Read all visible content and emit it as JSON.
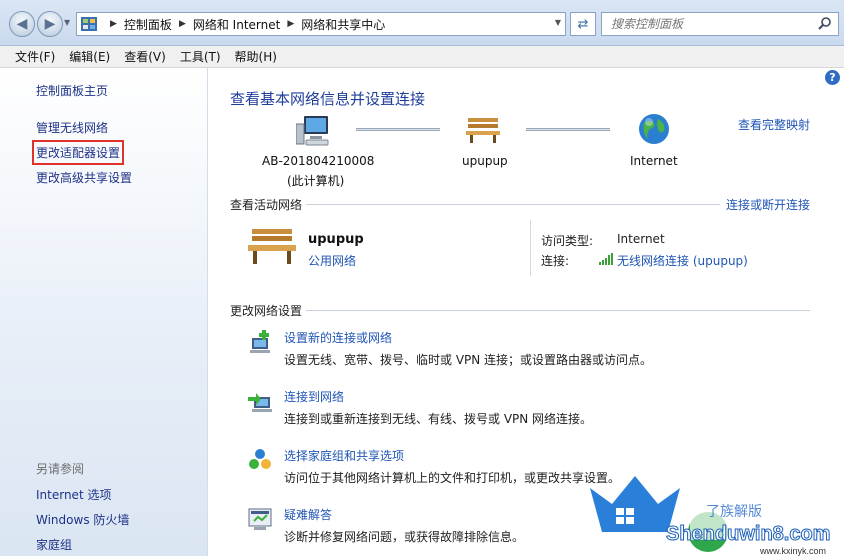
{
  "addressbar": {
    "breadcrumbs": [
      "控制面板",
      "网络和 Internet",
      "网络和共享中心"
    ],
    "search_placeholder": "搜索控制面板"
  },
  "menubar": {
    "items": [
      "文件(F)",
      "编辑(E)",
      "查看(V)",
      "工具(T)",
      "帮助(H)"
    ]
  },
  "sidebar": {
    "items": [
      {
        "label": "控制面板主页"
      },
      {
        "label": "管理无线网络"
      },
      {
        "label": "更改适配器设置",
        "highlighted": true
      },
      {
        "label": "更改高级共享设置"
      }
    ],
    "see_also_label": "另请参阅",
    "see_also": [
      "Internet 选项",
      "Windows 防火墙",
      "家庭组"
    ]
  },
  "main": {
    "title": "查看基本网络信息并设置连接",
    "full_map_link": "查看完整映射",
    "map": {
      "computer_name": "AB-201804210008",
      "computer_sub": "(此计算机)",
      "network_name": "upupup",
      "internet_name": "Internet"
    },
    "active_networks": {
      "header": "查看活动网络",
      "connect_link": "连接或断开连接",
      "network_name": "upupup",
      "network_type": "公用网络",
      "access_type_label": "访问类型:",
      "access_type_value": "Internet",
      "connections_label": "连接:",
      "connections_value": "无线网络连接 (upupup)"
    },
    "change_settings": {
      "header": "更改网络设置",
      "tasks": [
        {
          "link": "设置新的连接或网络",
          "desc": "设置无线、宽带、拨号、临时或 VPN 连接；或设置路由器或访问点。",
          "icon": "new-connection-icon"
        },
        {
          "link": "连接到网络",
          "desc": "连接到或重新连接到无线、有线、拨号或 VPN 网络连接。",
          "icon": "connect-network-icon"
        },
        {
          "link": "选择家庭组和共享选项",
          "desc": "访问位于其他网络计算机上的文件和打印机，或更改共享设置。",
          "icon": "homegroup-icon"
        },
        {
          "link": "疑难解答",
          "desc": "诊断并修复网络问题，或获得故障排除信息。",
          "icon": "troubleshoot-icon"
        }
      ]
    }
  },
  "watermark": {
    "text": "Shenduwin8.com",
    "sub": "www.kxinyk.com"
  },
  "colors": {
    "link": "#1f55b5",
    "title": "#1f3d9b",
    "highlight_box": "#e0312a"
  }
}
